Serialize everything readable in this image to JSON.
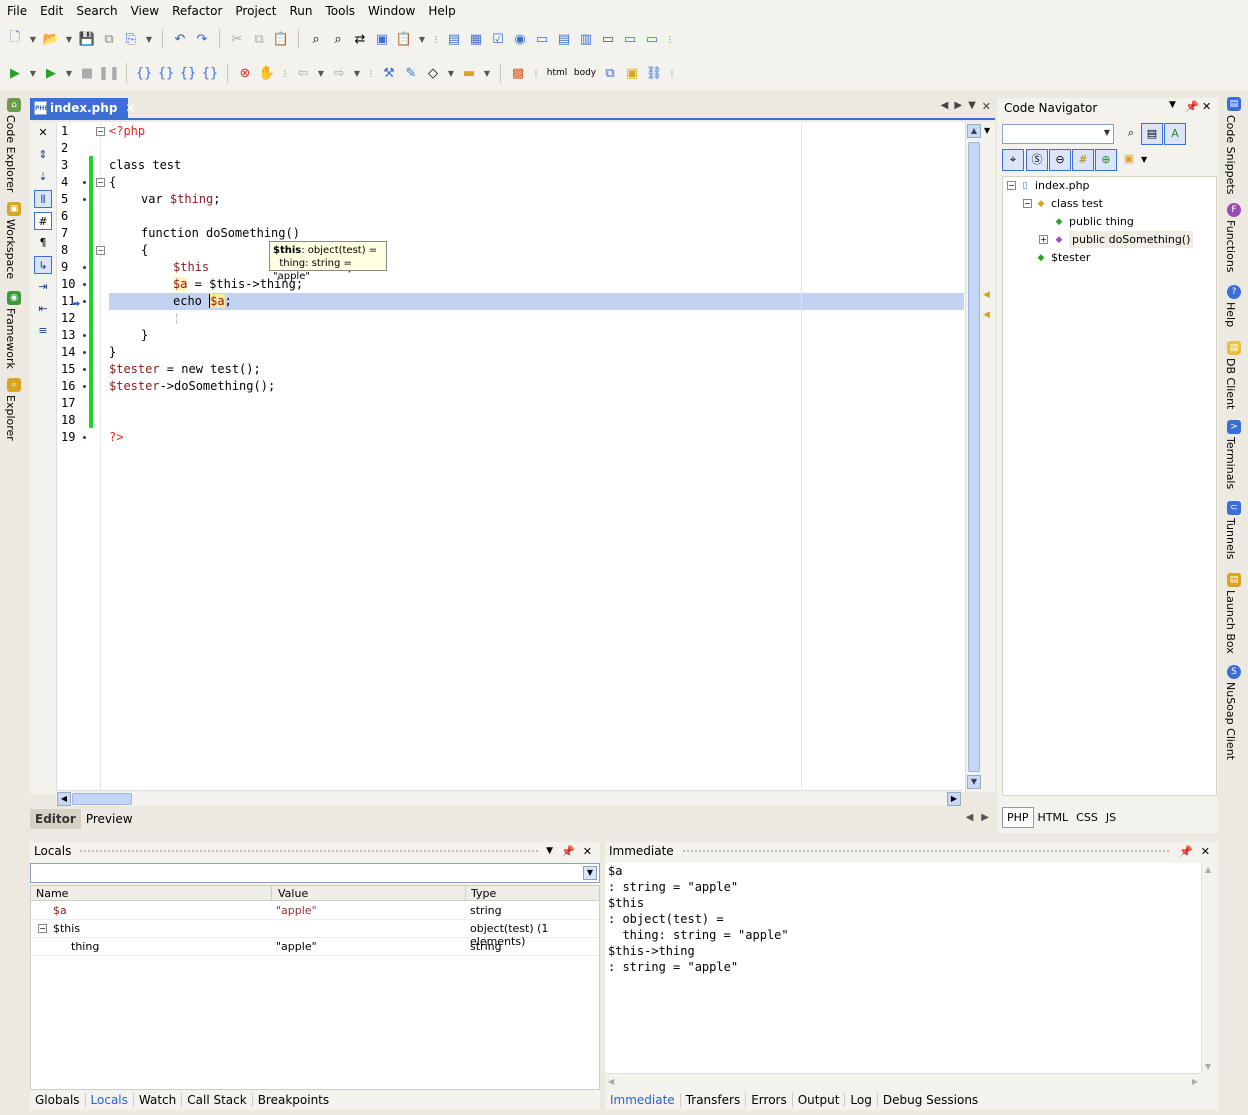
{
  "menu": [
    "File",
    "Edit",
    "Search",
    "View",
    "Refactor",
    "Project",
    "Run",
    "Tools",
    "Window",
    "Help"
  ],
  "toolbar": {
    "html_label": "html",
    "body_label": "body"
  },
  "left_panels": [
    "Code Explorer",
    "Workspace",
    "Framework",
    "Explorer"
  ],
  "right_panels": [
    "Code Snippets",
    "Functions",
    "Help",
    "DB Client",
    "Terminals",
    "Tunnels",
    "Launch Box",
    "NuSoap Client"
  ],
  "editor": {
    "tab_label": "index.php",
    "file_icon": "PHP",
    "lines": [
      {
        "n": "1"
      },
      {
        "n": "2"
      },
      {
        "n": "3"
      },
      {
        "n": "4"
      },
      {
        "n": "5"
      },
      {
        "n": "6"
      },
      {
        "n": "7"
      },
      {
        "n": "8"
      },
      {
        "n": "9"
      },
      {
        "n": "10"
      },
      {
        "n": "11"
      },
      {
        "n": "12"
      },
      {
        "n": "13"
      },
      {
        "n": "14"
      },
      {
        "n": "15"
      },
      {
        "n": "16"
      },
      {
        "n": "17"
      },
      {
        "n": "18"
      },
      {
        "n": "19"
      }
    ],
    "code": {
      "l1": "<?php",
      "l3": "class test",
      "l4": "{",
      "l5a": "var ",
      "l5b": "$thing",
      "l5c": ";",
      "l7": "function doSomething()",
      "l8": "{",
      "l9a": "$this",
      "l9b": "'",
      "l9c": ";",
      "l10a": "$a",
      "l10b": " = $this->thing;",
      "l11a": "echo ",
      "l11b": "$a",
      "l11c": ";",
      "l13": "}",
      "l14": "}",
      "l15a": "$tester",
      "l15b": " = new test();",
      "l16a": "$tester",
      "l16b": "->doSomething();",
      "l19": "?>"
    },
    "tooltip": {
      "bold": "$this",
      "line1": ": object(test) =",
      "line2": "thing: string = \"apple\""
    },
    "view_tabs": [
      "Editor",
      "Preview"
    ]
  },
  "navigator": {
    "title": "Code Navigator",
    "tree": {
      "file": "index.php",
      "class": "class test",
      "prop": "public thing",
      "method": "public doSomething()",
      "var": "$tester"
    },
    "tabs": [
      "PHP",
      "HTML",
      "CSS",
      "JS"
    ]
  },
  "locals": {
    "title": "Locals",
    "columns": [
      "Name",
      "Value",
      "Type"
    ],
    "rows": [
      {
        "name": "$a",
        "value": "\"apple\"",
        "type": "string"
      },
      {
        "name": "$this",
        "value": "",
        "type": "object(test) (1 elements)"
      },
      {
        "name": "thing",
        "value": "\"apple\"",
        "type": "string"
      }
    ],
    "tabs": [
      "Globals",
      "Locals",
      "Watch",
      "Call Stack",
      "Breakpoints"
    ]
  },
  "immediate": {
    "title": "Immediate",
    "lines": [
      "$a",
      ": string = \"apple\"",
      "$this",
      ": object(test) =",
      "  thing: string = \"apple\"",
      "$this->thing",
      ": string = \"apple\""
    ],
    "tabs": [
      "Immediate",
      "Transfers",
      "Errors",
      "Output",
      "Log",
      "Debug Sessions"
    ]
  },
  "colors": {
    "accent": "#3b6fd6",
    "current_line": "#c2d2f2",
    "change_bar": "#25d02f",
    "php_tag": "#e8281e",
    "variable": "#8b1a1a"
  }
}
